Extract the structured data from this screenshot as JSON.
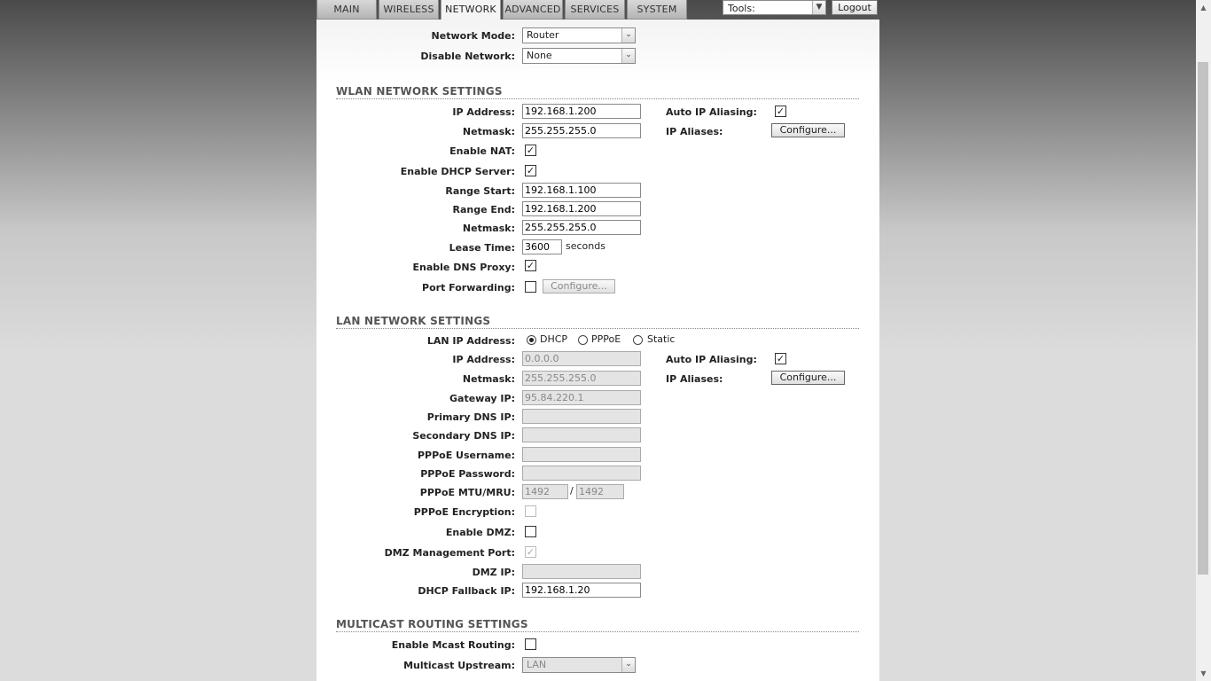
{
  "tabs": [
    {
      "label": "MAIN"
    },
    {
      "label": "WIRELESS"
    },
    {
      "label": "NETWORK"
    },
    {
      "label": "ADVANCED"
    },
    {
      "label": "SERVICES"
    },
    {
      "label": "SYSTEM"
    }
  ],
  "active_tab": "NETWORK",
  "tools": {
    "selected": "Tools:"
  },
  "logout_label": "Logout",
  "top": {
    "network_mode_label": "Network Mode:",
    "network_mode_value": "Router",
    "disable_network_label": "Disable Network:",
    "disable_network_value": "None"
  },
  "wlan": {
    "title": "WLAN NETWORK SETTINGS",
    "ip_label": "IP Address:",
    "ip_value": "192.168.1.200",
    "netmask_label": "Netmask:",
    "netmask_value": "255.255.255.0",
    "auto_alias_label": "Auto IP Aliasing:",
    "auto_alias_checked": true,
    "ip_aliases_label": "IP Aliases:",
    "configure_label": "Configure...",
    "nat_label": "Enable NAT:",
    "nat_checked": true,
    "dhcp_label": "Enable DHCP Server:",
    "dhcp_checked": true,
    "range_start_label": "Range Start:",
    "range_start_value": "192.168.1.100",
    "range_end_label": "Range End:",
    "range_end_value": "192.168.1.200",
    "dhcp_netmask_label": "Netmask:",
    "dhcp_netmask_value": "255.255.255.0",
    "lease_label": "Lease Time:",
    "lease_value": "3600",
    "lease_unit": "seconds",
    "dns_proxy_label": "Enable DNS Proxy:",
    "dns_proxy_checked": true,
    "port_fwd_label": "Port Forwarding:",
    "port_fwd_checked": false,
    "port_fwd_configure": "Configure..."
  },
  "lan": {
    "title": "LAN NETWORK SETTINGS",
    "lan_ip_label": "LAN IP Address:",
    "modes": [
      "DHCP",
      "PPPoE",
      "Static"
    ],
    "selected_mode": "DHCP",
    "ip_label": "IP Address:",
    "ip_value": "0.0.0.0",
    "netmask_label": "Netmask:",
    "netmask_value": "255.255.255.0",
    "auto_alias_label": "Auto IP Aliasing:",
    "auto_alias_checked": true,
    "ip_aliases_label": "IP Aliases:",
    "configure_label": "Configure...",
    "gateway_label": "Gateway IP:",
    "gateway_value": "95.84.220.1",
    "primary_dns_label": "Primary DNS IP:",
    "primary_dns_value": "",
    "secondary_dns_label": "Secondary DNS IP:",
    "secondary_dns_value": "",
    "pppoe_user_label": "PPPoE Username:",
    "pppoe_user_value": "",
    "pppoe_pass_label": "PPPoE Password:",
    "pppoe_pass_value": "",
    "pppoe_mtu_label": "PPPoE MTU/MRU:",
    "pppoe_mtu_value": "1492",
    "pppoe_mru_value": "1492",
    "mtu_sep": "/",
    "pppoe_enc_label": "PPPoE Encryption:",
    "pppoe_enc_checked": false,
    "dmz_label": "Enable DMZ:",
    "dmz_checked": false,
    "dmz_mgmt_label": "DMZ Management Port:",
    "dmz_mgmt_checked": true,
    "dmz_ip_label": "DMZ IP:",
    "dmz_ip_value": "",
    "fallback_label": "DHCP Fallback IP:",
    "fallback_value": "192.168.1.20"
  },
  "mcast": {
    "title": "MULTICAST ROUTING SETTINGS",
    "enable_label": "Enable Mcast Routing:",
    "enable_checked": false,
    "upstream_label": "Multicast Upstream:",
    "upstream_value": "LAN"
  }
}
